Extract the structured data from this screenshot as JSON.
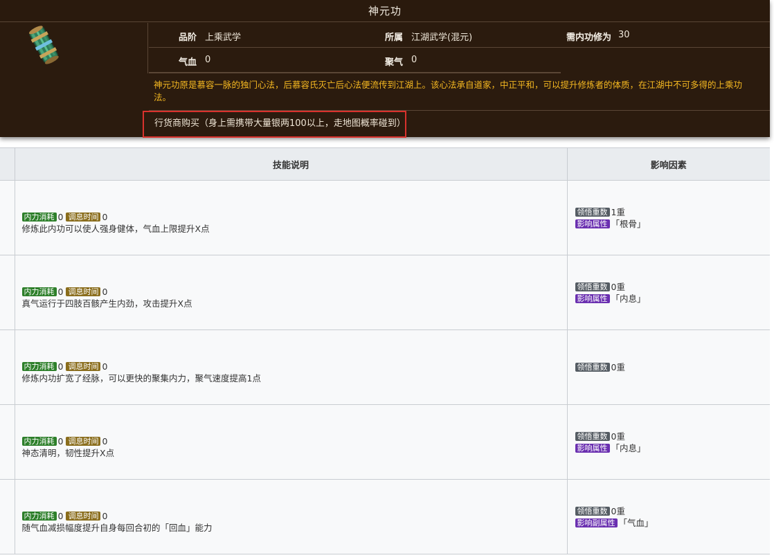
{
  "skill": {
    "title": "神元功",
    "icon": "scroll-icon",
    "grade_label": "品阶",
    "grade": "上乘武学",
    "faction_label": "所属",
    "faction": "江湖武学(混元)",
    "req_label": "需内功修为",
    "req_value": "30",
    "hp_label": "气血",
    "hp_value": "0",
    "qi_label": "聚气",
    "qi_value": "0",
    "description": "神元功原是慕容一脉的独门心法，后慕容氏灭亡后心法便流传到江湖上。该心法承自道家，中正平和，可以提升修炼者的体质，在江湖中不可多得的上乘功法。",
    "source": "行货商购买（身上需携带大量银两100以上，走地图概率碰到）"
  },
  "table": {
    "col_desc": "技能说明",
    "col_factor": "影响因素",
    "rows": [
      {
        "neili_label": "内力消耗",
        "neili": "0",
        "tiaoxi_label": "调息时间",
        "tiaoxi": "0",
        "desc": "修炼此内功可以使人强身健体，气血上限提升X点",
        "level_label": "领悟重数",
        "level": "1重",
        "attr_label": "影响属性",
        "attr": "「根骨」"
      },
      {
        "neili_label": "内力消耗",
        "neili": "0",
        "tiaoxi_label": "调息时间",
        "tiaoxi": "0",
        "desc": "真气运行于四肢百骸产生内劲，攻击提升X点",
        "level_label": "领悟重数",
        "level": "0重",
        "attr_label": "影响属性",
        "attr": "「内息」"
      },
      {
        "neili_label": "内力消耗",
        "neili": "0",
        "tiaoxi_label": "调息时间",
        "tiaoxi": "0",
        "desc": "修炼内功扩宽了经脉，可以更快的聚集内力，聚气速度提高1点",
        "level_label": "领悟重数",
        "level": "0重"
      },
      {
        "neili_label": "内力消耗",
        "neili": "0",
        "tiaoxi_label": "调息时间",
        "tiaoxi": "0",
        "desc": "神态清明，韧性提升X点",
        "level_label": "领悟重数",
        "level": "0重",
        "attr_label": "影响属性",
        "attr": "「内息」"
      },
      {
        "neili_label": "内力消耗",
        "neili": "0",
        "tiaoxi_label": "调息时间",
        "tiaoxi": "0",
        "desc": "随气血减损幅度提升自身每回合初的「回血」能力",
        "level_label": "领悟重数",
        "level": "0重",
        "attr_label": "影响副属性",
        "attr": "「气血」"
      }
    ]
  },
  "colors": {
    "panel_bg": "#2b1b0e",
    "description_text": "#f5b821",
    "highlight_border": "#d9322d",
    "badge_neili": "#2d7f2a",
    "badge_tiaoxi": "#8a6d1c",
    "badge_level": "#555c63",
    "badge_attr": "#6a2fb0"
  }
}
